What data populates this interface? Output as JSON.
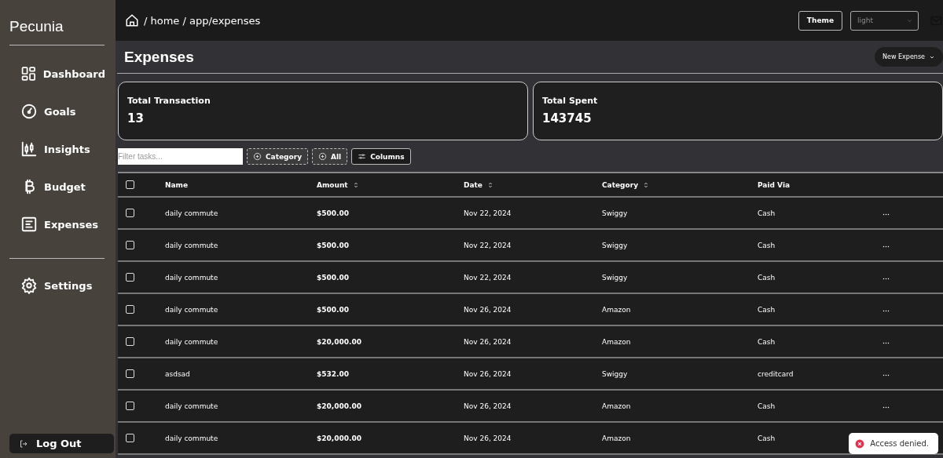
{
  "sidebar": {
    "brand": "Pecunia",
    "items": [
      {
        "label": "Dashboard"
      },
      {
        "label": "Goals"
      },
      {
        "label": "Insights"
      },
      {
        "label": "Budget"
      },
      {
        "label": "Expenses"
      }
    ],
    "bottom_items": [
      {
        "label": "Settings"
      }
    ],
    "logout": "Log Out"
  },
  "topbar": {
    "breadcrumb": "/ home / app/expenses",
    "theme_button": "Theme",
    "theme_select": {
      "placeholder": "light"
    }
  },
  "page": {
    "title": "Expenses",
    "new_button": "New Expense"
  },
  "stats": [
    {
      "label": "Total Transaction",
      "value": "13"
    },
    {
      "label": "Total Spent",
      "value": "143745"
    }
  ],
  "toolbar": {
    "filter": {
      "placeholder": "Filter tasks..."
    },
    "facets": [
      "Category",
      "All"
    ],
    "columns_button": "Columns"
  },
  "table": {
    "header_checked": false,
    "columns": [
      {
        "label": "Name",
        "sortable": false
      },
      {
        "label": "Amount",
        "sortable": true
      },
      {
        "label": "Date",
        "sortable": true
      },
      {
        "label": "Category",
        "sortable": true
      },
      {
        "label": "Paid Via",
        "sortable": false
      }
    ],
    "rows": [
      {
        "checked": false,
        "cells": [
          "daily commute",
          "$500.00",
          "Nov 22, 2024",
          "Swiggy",
          "Cash"
        ]
      },
      {
        "checked": false,
        "cells": [
          "daily commute",
          "$500.00",
          "Nov 22, 2024",
          "Swiggy",
          "Cash"
        ]
      },
      {
        "checked": false,
        "cells": [
          "daily commute",
          "$500.00",
          "Nov 22, 2024",
          "Swiggy",
          "Cash"
        ]
      },
      {
        "checked": false,
        "cells": [
          "daily commute",
          "$500.00",
          "Nov 26, 2024",
          "Amazon",
          "Cash"
        ]
      },
      {
        "checked": false,
        "cells": [
          "daily commute",
          "$20,000.00",
          "Nov 26, 2024",
          "Amazon",
          "Cash"
        ]
      },
      {
        "checked": false,
        "cells": [
          "asdsad",
          "$532.00",
          "Nov 26, 2024",
          "Swiggy",
          "creditcard"
        ]
      },
      {
        "checked": false,
        "cells": [
          "daily commute",
          "$20,000.00",
          "Nov 26, 2024",
          "Amazon",
          "Cash"
        ]
      },
      {
        "checked": false,
        "cells": [
          "daily commute",
          "$20,000.00",
          "Nov 26, 2024",
          "Amazon",
          "Cash"
        ]
      }
    ]
  },
  "toast": {
    "message": "Access denied."
  }
}
